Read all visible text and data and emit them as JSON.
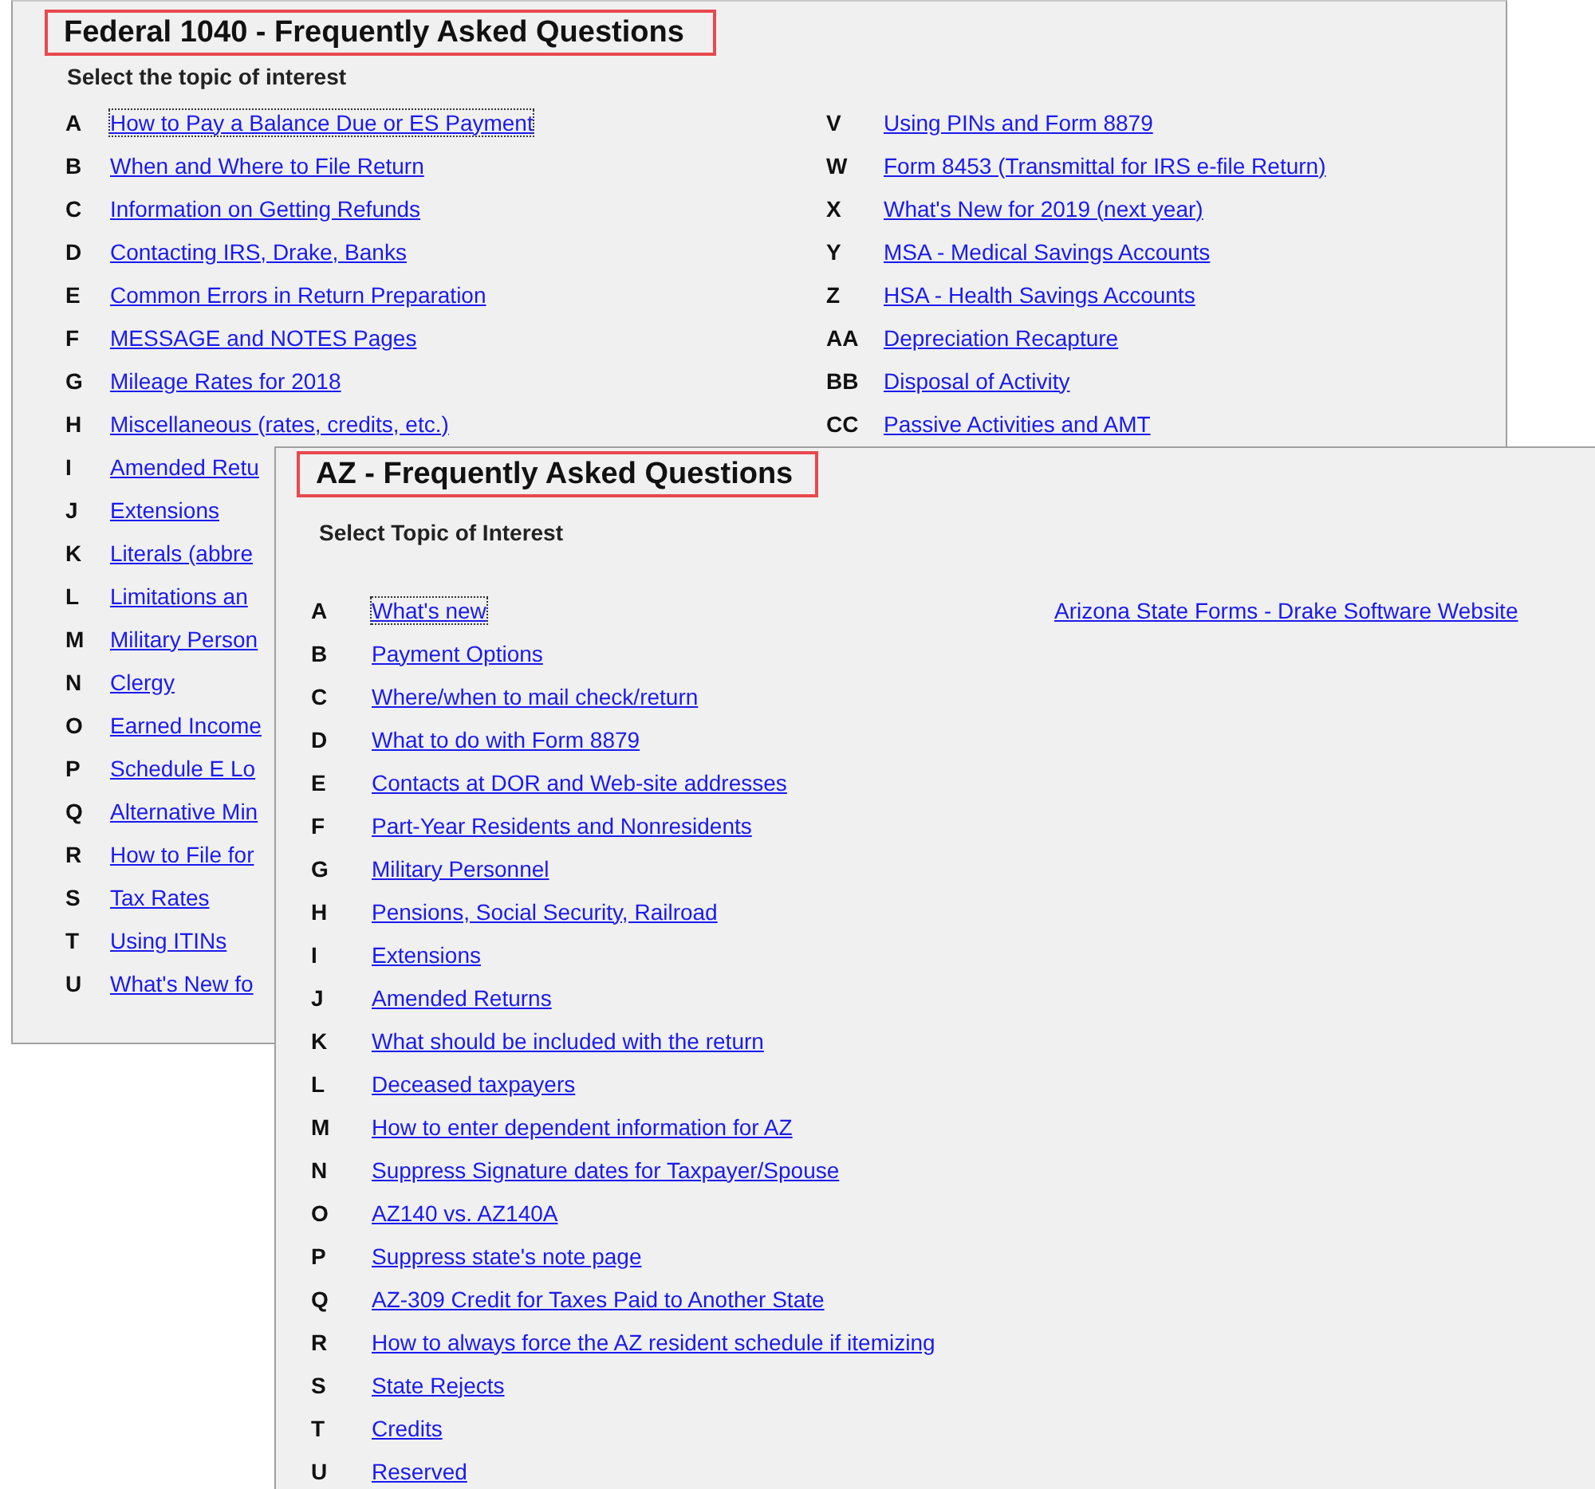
{
  "federal_panel": {
    "title": "Federal 1040 - Frequently Asked Questions",
    "subtitle": "Select the topic of interest",
    "left_topics": [
      {
        "letter": "A",
        "link": "How to Pay a Balance Due or ES Payment",
        "focused": true
      },
      {
        "letter": "B",
        "link": "When and Where to File Return",
        "focused": false
      },
      {
        "letter": "C",
        "link": "Information on Getting Refunds",
        "focused": false
      },
      {
        "letter": "D",
        "link": "Contacting IRS, Drake, Banks",
        "focused": false
      },
      {
        "letter": "E",
        "link": "Common Errors in Return Preparation",
        "focused": false
      },
      {
        "letter": "F",
        "link": "MESSAGE and NOTES Pages",
        "focused": false
      },
      {
        "letter": "G",
        "link": "Mileage Rates for 2018",
        "focused": false
      },
      {
        "letter": "H",
        "link": "Miscellaneous (rates, credits, etc.)",
        "focused": false
      },
      {
        "letter": "I",
        "link": "Amended Retu",
        "focused": false
      },
      {
        "letter": "J",
        "link": "Extensions",
        "focused": false
      },
      {
        "letter": "K",
        "link": "Literals (abbre",
        "focused": false
      },
      {
        "letter": "L",
        "link": "Limitations an",
        "focused": false
      },
      {
        "letter": "M",
        "link": "Military Person",
        "focused": false
      },
      {
        "letter": "N",
        "link": "Clergy",
        "focused": false
      },
      {
        "letter": "O",
        "link": "Earned Income",
        "focused": false
      },
      {
        "letter": "P",
        "link": "Schedule E Lo",
        "focused": false
      },
      {
        "letter": "Q",
        "link": "Alternative Min",
        "focused": false
      },
      {
        "letter": "R",
        "link": "How to File for",
        "focused": false
      },
      {
        "letter": "S",
        "link": "Tax Rates",
        "focused": false
      },
      {
        "letter": "T",
        "link": "Using ITINs",
        "focused": false
      },
      {
        "letter": "U",
        "link": "What's New fo",
        "focused": false
      }
    ],
    "right_topics": [
      {
        "letter": "V",
        "link": "Using PINs and Form 8879",
        "focused": false
      },
      {
        "letter": "W",
        "link": "Form 8453 (Transmittal for IRS e-file Return)",
        "focused": false
      },
      {
        "letter": "X",
        "link": "What's New for 2019 (next year)",
        "focused": false
      },
      {
        "letter": "Y",
        "link": "MSA - Medical Savings Accounts",
        "focused": false
      },
      {
        "letter": "Z",
        "link": "HSA - Health Savings Accounts",
        "focused": false
      },
      {
        "letter": "AA",
        "link": "Depreciation Recapture",
        "focused": false
      },
      {
        "letter": "BB",
        "link": "Disposal of Activity",
        "focused": false
      },
      {
        "letter": "CC",
        "link": "Passive Activities and AMT",
        "focused": false
      }
    ]
  },
  "az_panel": {
    "title": "AZ - Frequently Asked Questions",
    "subtitle": "Select Topic of Interest",
    "website_link": "Arizona State Forms - Drake Software Website",
    "topics": [
      {
        "letter": "A",
        "link": "What's new",
        "focused": true
      },
      {
        "letter": "B",
        "link": "Payment Options",
        "focused": false
      },
      {
        "letter": "C",
        "link": "Where/when to mail check/return",
        "focused": false
      },
      {
        "letter": "D",
        "link": "What to do with Form 8879",
        "focused": false
      },
      {
        "letter": "E",
        "link": "Contacts at DOR and Web-site addresses",
        "focused": false
      },
      {
        "letter": "F",
        "link": "Part-Year Residents and Nonresidents",
        "focused": false
      },
      {
        "letter": "G",
        "link": "Military Personnel",
        "focused": false
      },
      {
        "letter": "H",
        "link": "Pensions, Social Security, Railroad",
        "focused": false
      },
      {
        "letter": "I",
        "link": "Extensions",
        "focused": false
      },
      {
        "letter": "J",
        "link": "Amended Returns",
        "focused": false
      },
      {
        "letter": "K",
        "link": "What should be included with the return",
        "focused": false
      },
      {
        "letter": "L",
        "link": "Deceased taxpayers",
        "focused": false
      },
      {
        "letter": "M",
        "link": "How to enter dependent information for AZ",
        "focused": false
      },
      {
        "letter": "N",
        "link": "Suppress Signature dates for Taxpayer/Spouse",
        "focused": false
      },
      {
        "letter": "O",
        "link": "AZ140 vs. AZ140A",
        "focused": false
      },
      {
        "letter": "P",
        "link": "Suppress state's note page",
        "focused": false
      },
      {
        "letter": "Q",
        "link": "AZ-309 Credit for Taxes Paid to Another State",
        "focused": false
      },
      {
        "letter": "R",
        "link": "How to always force the AZ resident schedule if itemizing",
        "focused": false
      },
      {
        "letter": "S",
        "link": "State Rejects",
        "focused": false
      },
      {
        "letter": "T",
        "link": "Credits",
        "focused": false
      },
      {
        "letter": "U",
        "link": "Reserved",
        "focused": false
      }
    ]
  }
}
